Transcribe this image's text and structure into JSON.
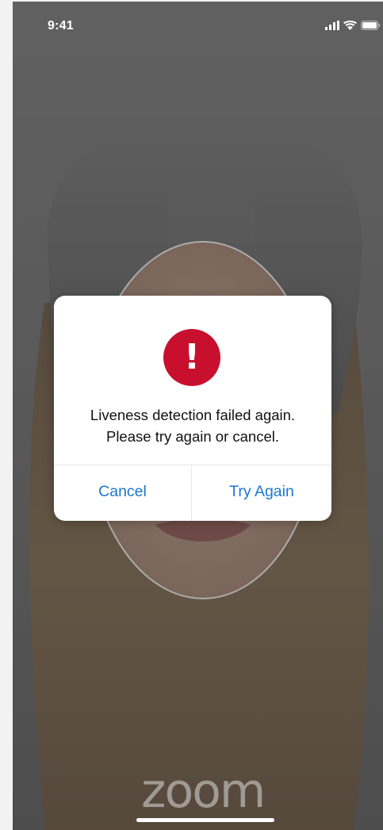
{
  "status_bar": {
    "time": "9:41",
    "icons": [
      "signal-icon",
      "wifi-icon",
      "battery-icon"
    ]
  },
  "dialog": {
    "icon": "exclamation-icon",
    "icon_glyph": "!",
    "icon_color": "#c8102e",
    "message_line1": "Liveness detection failed again.",
    "message_line2": "Please try again or cancel.",
    "cancel_label": "Cancel",
    "try_again_label": "Try Again",
    "button_color": "#1976d2"
  },
  "footer": {
    "logo_text": "zoom"
  }
}
